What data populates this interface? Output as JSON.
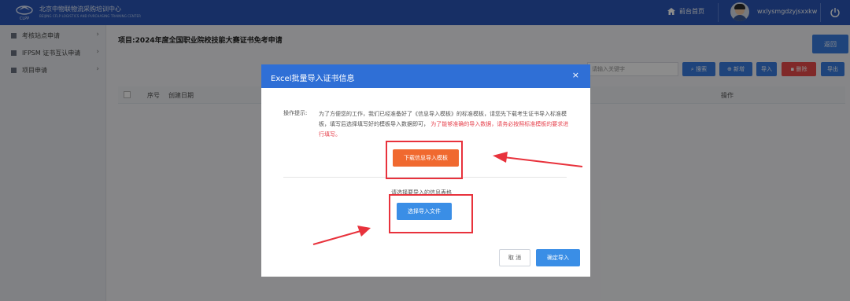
{
  "header": {
    "org_name": "北京中物联物流采购培训中心",
    "org_name_en": "BEIJING CFLP LOGISTICS AND PURCHASING TRAINING CENTER",
    "logo_letters": "CLPP",
    "home_label": "前台首页",
    "username": "wxlysmgdzyjsxxkw"
  },
  "sidebar": {
    "items": [
      {
        "label": "考核站点申请"
      },
      {
        "label": "IFPSM 证书互认申请"
      },
      {
        "label": "项目申请"
      }
    ]
  },
  "main": {
    "project_title": "项目:2024年度全国职业院校技能大赛证书免考申请",
    "return_label": "返回",
    "search_placeholder": "请输入关键字",
    "toolbar": {
      "search": "搜索",
      "add": "新增",
      "import": "导入",
      "delete": "删除",
      "export": "导出"
    },
    "table_headers": {
      "index": "序号",
      "created": "创建日期",
      "actions": "操作"
    }
  },
  "dialog": {
    "title": "Excel批量导入证书信息",
    "close": "×",
    "tip_label": "操作提示:",
    "tip_text": "为了方便您的工作，我们已经准备好了《信息导入模板》的标准模板，请您先下载考生证书导入标准模板，填写后选择填写好的模板导入数据即可，",
    "tip_warning": "为了能够准确的导入数据，请务必按照标准模板的要求进行填写。",
    "download_label": "下载信息导入模板",
    "select_label": "请选择要导入的信息表格",
    "file_label": "选择导入文件",
    "cancel_label": "取 消",
    "confirm_label": "确定导入"
  },
  "colors": {
    "topbar": "#2a57b8",
    "dialog_header": "#2f6fd6",
    "download": "#f0692f",
    "primary": "#3a8ee6",
    "annotation": "#e8323c"
  }
}
